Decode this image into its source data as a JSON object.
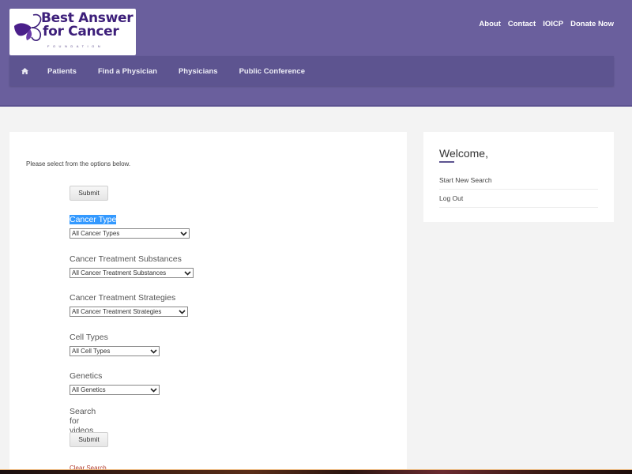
{
  "brand": {
    "logo_line1": "Best Answer",
    "logo_line2": "for Cancer",
    "logo_sub": "FOUNDATION",
    "primary_color": "#6a5f9d",
    "nav_color": "#5d5490",
    "logo_color": "#3d1f7a"
  },
  "top_links": [
    "About",
    "Contact",
    "IOICP",
    "Donate Now"
  ],
  "nav": {
    "home_icon": "home-icon",
    "items": [
      "Patients",
      "Find a Physician",
      "Physicians",
      "Public Conference"
    ]
  },
  "main": {
    "intro": "Please select from the options below.",
    "submit_label": "Submit",
    "fields": [
      {
        "label": "Cancer Type",
        "value": "All Cancer Types",
        "selected": true
      },
      {
        "label": "Cancer Treatment Substances",
        "value": "All Cancer Treatment Substances"
      },
      {
        "label": "Cancer Treatment Strategies",
        "value": "All Cancer Treatment Strategies"
      },
      {
        "label": "Cell Types",
        "value": "All Cell Types"
      },
      {
        "label": "Genetics",
        "value": "All Genetics"
      }
    ],
    "videos_label": "Search for videos only",
    "clear_label": "Clear Search"
  },
  "sidebar": {
    "title": "Welcome,",
    "links": [
      "Start New Search",
      "Log Out"
    ]
  }
}
